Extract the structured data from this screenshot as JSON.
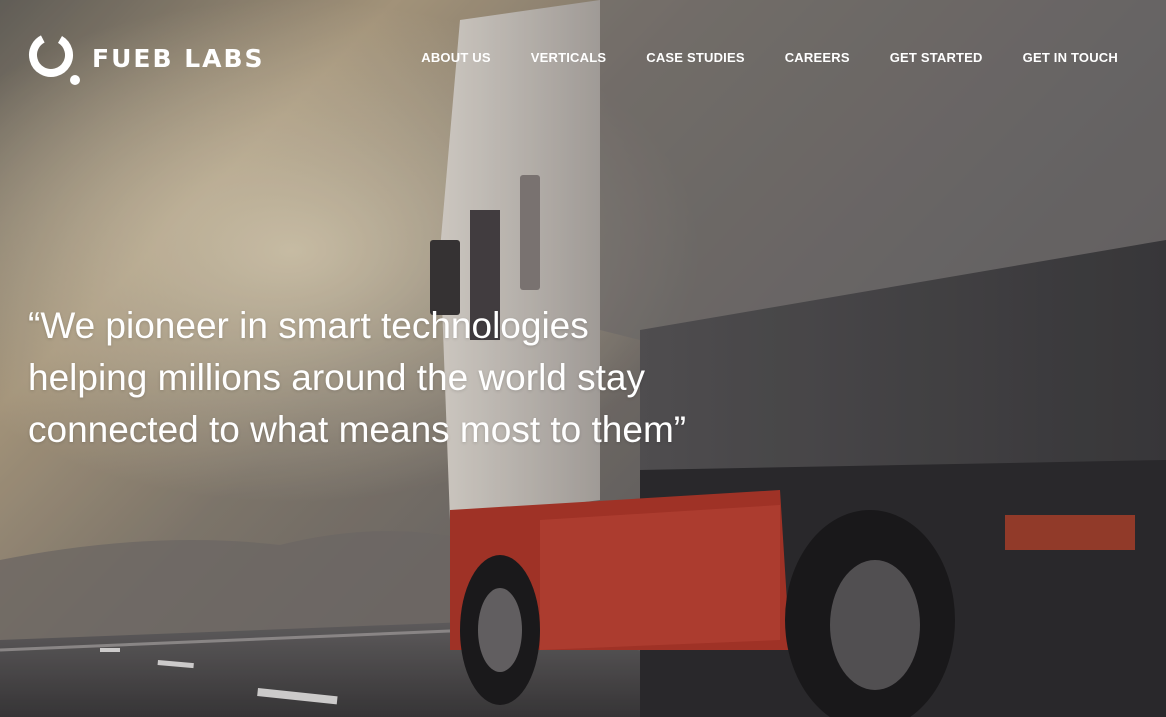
{
  "brand": {
    "name": "FUEB LABS",
    "logo_icon": "ring-dot-logo-icon"
  },
  "nav": {
    "items": [
      {
        "label": "ABOUT US"
      },
      {
        "label": "VERTICALS"
      },
      {
        "label": "CASE STUDIES"
      },
      {
        "label": "CAREERS"
      },
      {
        "label": "GET STARTED"
      },
      {
        "label": "GET IN TOUCH"
      }
    ]
  },
  "hero": {
    "quote": "“We pioneer in smart technologies helping millions around the world stay connected to what means most to them”",
    "background": "truck-on-highway-sunset-photo"
  },
  "colors": {
    "text": "#ffffff",
    "overlay": "#5a5656",
    "truck_red": "#c0392b"
  }
}
